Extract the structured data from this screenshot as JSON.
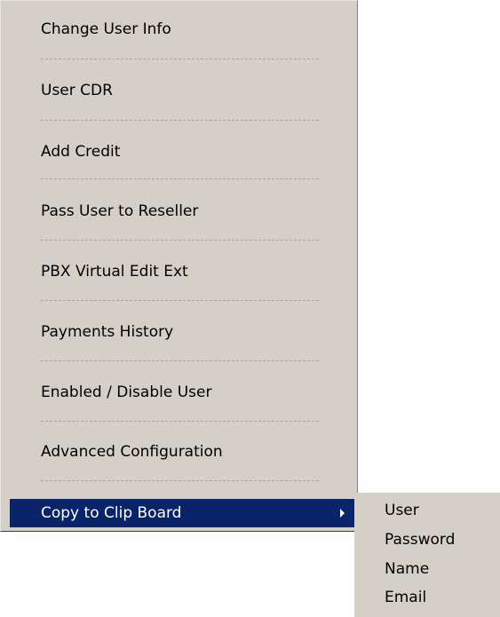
{
  "context_menu": {
    "items": [
      {
        "label": "Change User Info"
      },
      {
        "label": "User CDR"
      },
      {
        "label": "Add Credit"
      },
      {
        "label": "Pass User to Reseller"
      },
      {
        "label": "PBX Virtual Edit Ext"
      },
      {
        "label": "Payments History"
      },
      {
        "label": "Enabled / Disable User"
      },
      {
        "label": "Advanced Configuration"
      },
      {
        "label": "Copy to Clip Board",
        "highlighted": true,
        "has_submenu": true
      }
    ],
    "highlight_color": "#0a246a",
    "background_color": "#d4d0c8"
  },
  "submenu": {
    "items": [
      {
        "label": "User"
      },
      {
        "label": "Password"
      },
      {
        "label": "Name"
      },
      {
        "label": "Email"
      }
    ]
  }
}
